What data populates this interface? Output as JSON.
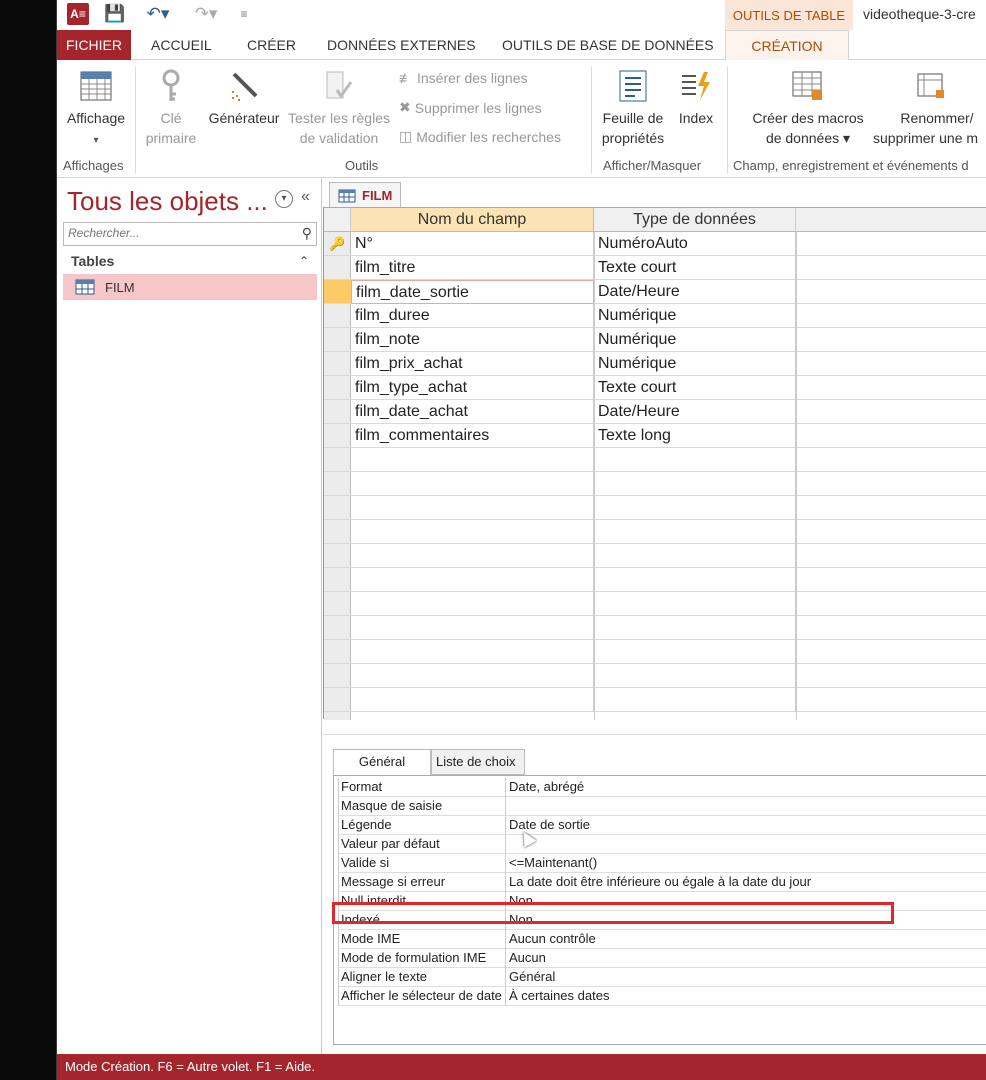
{
  "titlebar": {
    "tools_context": "OUTILS DE TABLE",
    "document_title": "videotheque-3-cre",
    "access_logo": "A≡"
  },
  "tabs": {
    "fichier": "FICHIER",
    "accueil": "ACCUEIL",
    "creer": "CRÉER",
    "donnees_externes": "DONNÉES EXTERNES",
    "outils_bdd": "OUTILS DE BASE DE DONNÉES",
    "creation": "CRÉATION"
  },
  "ribbon": {
    "affichage": "Affichage",
    "cle_primaire": [
      "Clé",
      "primaire"
    ],
    "generateur": "Générateur",
    "tester_regles": [
      "Tester les règles",
      "de validation"
    ],
    "inserer_lignes": "Insérer des lignes",
    "supprimer_lignes": "Supprimer les lignes",
    "modifier_recherches": "Modifier les recherches",
    "feuille_proprietes": [
      "Feuille de",
      "propriétés"
    ],
    "index": "Index",
    "creer_macros": [
      "Créer des macros",
      "de données ▾"
    ],
    "renommer": [
      "Renommer/",
      "supprimer une m"
    ],
    "groups": {
      "affichages": "Affichages",
      "outils": "Outils",
      "afficher_masquer": "Afficher/Masquer",
      "champ_evenements": "Champ, enregistrement et événements d"
    }
  },
  "nav": {
    "title": "Tous les objets ...",
    "search_placeholder": "Rechercher...",
    "group": "Tables",
    "items": [
      {
        "label": "FILM"
      }
    ]
  },
  "document": {
    "tab_label": "FILM",
    "columns": [
      "Nom du champ",
      "Type de données"
    ],
    "rows": [
      {
        "name": "N°",
        "type": "NuméroAuto",
        "key": true
      },
      {
        "name": "film_titre",
        "type": "Texte court"
      },
      {
        "name": "film_date_sortie",
        "type": "Date/Heure",
        "current": true
      },
      {
        "name": "film_duree",
        "type": "Numérique"
      },
      {
        "name": "film_note",
        "type": "Numérique"
      },
      {
        "name": "film_prix_achat",
        "type": "Numérique"
      },
      {
        "name": "film_type_achat",
        "type": "Texte court"
      },
      {
        "name": "film_date_achat",
        "type": "Date/Heure"
      },
      {
        "name": "film_commentaires",
        "type": "Texte long"
      }
    ]
  },
  "properties": {
    "tabs": [
      "Général",
      "Liste de choix"
    ],
    "rows": [
      {
        "key": "Format",
        "value": "Date, abrégé"
      },
      {
        "key": "Masque de saisie",
        "value": ""
      },
      {
        "key": "Légende",
        "value": "Date de sortie"
      },
      {
        "key": "Valeur par défaut",
        "value": ""
      },
      {
        "key": "Valide si",
        "value": "<=Maintenant()"
      },
      {
        "key": "Message si erreur",
        "value": "La date doit être inférieure ou égale à la date du jour"
      },
      {
        "key": "Null interdit",
        "value": "Non"
      },
      {
        "key": "Indexé",
        "value": "Non"
      },
      {
        "key": "Mode IME",
        "value": "Aucun contrôle"
      },
      {
        "key": "Mode de formulation IME",
        "value": "Aucun"
      },
      {
        "key": "Aligner le texte",
        "value": "Général"
      },
      {
        "key": "Afficher le sélecteur de date",
        "value": "À certaines dates"
      }
    ]
  },
  "status": {
    "text": "Mode Création. F6 = Autre volet. F1 = Aide."
  },
  "colors": {
    "brand": "#a4262c",
    "context_tab": "#b04a00",
    "highlight": "#e3262b"
  }
}
